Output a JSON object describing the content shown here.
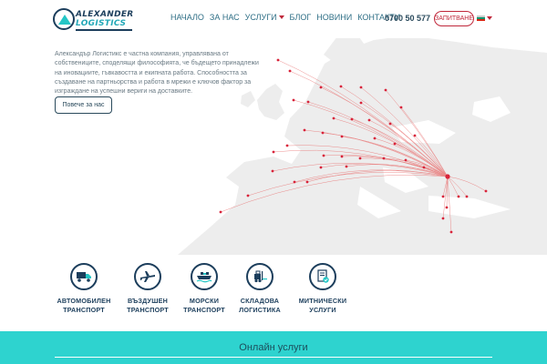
{
  "header": {
    "logo_line1": "ALEXANDER",
    "logo_line2": "LOGISTICS",
    "nav": [
      {
        "label": "НАЧАЛО"
      },
      {
        "label": "ЗА НАС"
      },
      {
        "label": "УСЛУГИ",
        "has_dropdown": true
      },
      {
        "label": "БЛОГ"
      },
      {
        "label": "НОВИНИ"
      },
      {
        "label": "КОНТАКТИ"
      }
    ],
    "phone": "0700 50 577",
    "cta_label": "ЗАПИТВАНЕ",
    "language_flag": "bulgarian-flag",
    "colors": {
      "brand_navy": "#1c3e5c",
      "brand_teal": "#24c6c6",
      "accent_red": "#c0273a"
    }
  },
  "intro": {
    "text": "Александър Логистикс е частна компания, управлявана от собствениците, споделящи философията, че бъдещето принадлежи на иновациите, гъвкавостта и екипната работа. Способността за създаване на партньорства и работа в мрежи е ключов фактор за изграждане на успешни вериги на доставките.",
    "button_label": "Повече за нас"
  },
  "services": [
    {
      "icon": "truck-icon",
      "line1": "АВТОМОБИЛЕН",
      "line2": "ТРАНСПОРТ"
    },
    {
      "icon": "airplane-icon",
      "line1": "ВЪЗДУШЕН",
      "line2": "ТРАНСПОРТ"
    },
    {
      "icon": "ship-icon",
      "line1": "МОРСКИ",
      "line2": "ТРАНСПОРТ"
    },
    {
      "icon": "forklift-icon",
      "line1": "СКЛАДОВА",
      "line2": "ЛОГИСТИКА"
    },
    {
      "icon": "customs-document-icon",
      "line1": "МИТНИЧЕСКИ",
      "line2": "УСЛУГИ"
    }
  ],
  "online": {
    "title": "Онлайн услуги",
    "band_color": "#2ed3cf"
  }
}
